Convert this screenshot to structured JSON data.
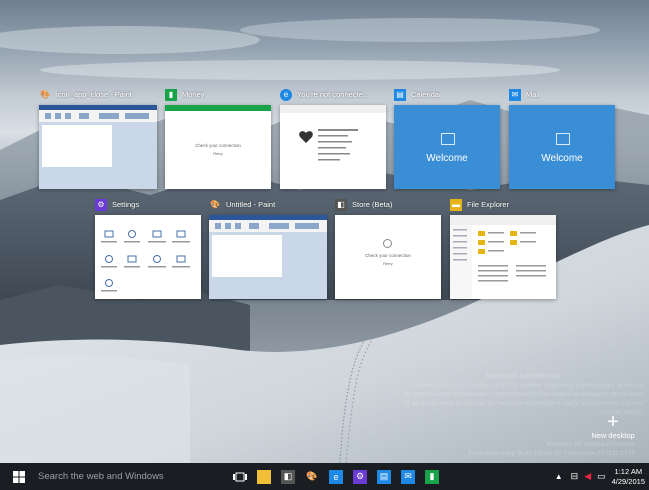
{
  "task_view": {
    "windows_row1": [
      {
        "title": "icon_app_close - Paint",
        "icon": "paint-icon",
        "color": "#00a2e8"
      },
      {
        "title": "Money",
        "icon": "money-icon",
        "color": "#18a34a"
      },
      {
        "title": "You're not connecte...",
        "icon": "edge-icon",
        "color": "#1e88e5"
      },
      {
        "title": "Calendar",
        "icon": "calendar-icon",
        "color": "#1e88e5",
        "content": "Welcome"
      },
      {
        "title": "Mail",
        "icon": "mail-icon",
        "color": "#1e88e5",
        "content": "Welcome"
      }
    ],
    "windows_row2": [
      {
        "title": "Settings",
        "icon": "gear-icon",
        "color": "#6a3ad6"
      },
      {
        "title": "Untitled - Paint",
        "icon": "paint-icon",
        "color": "#00a2e8"
      },
      {
        "title": "Store (Beta)",
        "icon": "store-icon",
        "color": "#555555"
      },
      {
        "title": "File Explorer",
        "icon": "folder-icon",
        "color": "#e7b416"
      }
    ],
    "new_desktop": {
      "plus": "+",
      "label": "New desktop"
    }
  },
  "watermark": {
    "title": "Microsoft Confidential",
    "body": "Unauthorized use or disclosure in any manner may result in disciplinary action up to and including termination of employment (in the case of employees), termination of an assignment or contract (in the case of contingent staff), and potential civil and criminal liability.",
    "build": "Windows 10 Technical Preview\nEvaluation copy. Build 10041.fbl_impressive.150311-1730"
  },
  "taskbar": {
    "search_placeholder": "Search the web and Windows",
    "pinned": [
      {
        "name": "task-view-icon"
      },
      {
        "name": "file-explorer-icon",
        "color": "#f2c037"
      },
      {
        "name": "store-icon",
        "color": "#555555"
      },
      {
        "name": "paint-icon",
        "color": "#00a2e8"
      },
      {
        "name": "edge-icon",
        "color": "#1e88e5"
      },
      {
        "name": "settings-icon",
        "color": "#6a3ad6"
      },
      {
        "name": "calendar-icon",
        "color": "#1e88e5"
      },
      {
        "name": "mail-icon",
        "color": "#1e88e5"
      },
      {
        "name": "money-icon",
        "color": "#18a34a"
      }
    ],
    "time": "1:12 AM",
    "date": "4/29/2015"
  },
  "thumb_text": {
    "check_connection": "Check your connection",
    "retry": "Retry"
  }
}
